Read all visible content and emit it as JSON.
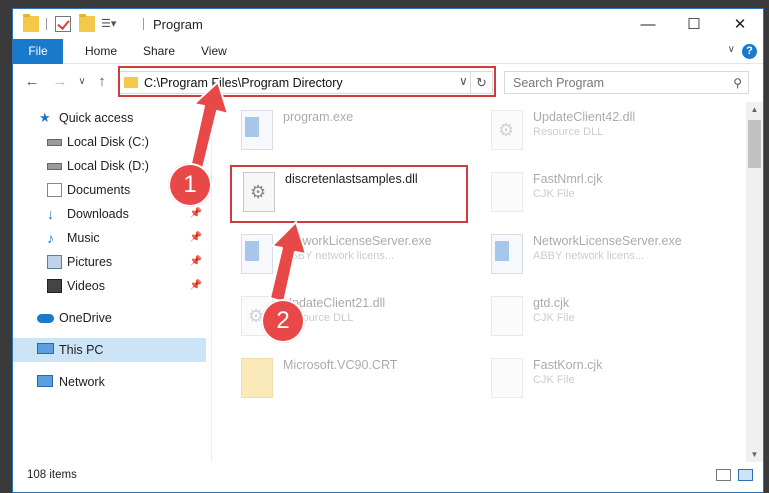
{
  "window": {
    "title": "Program",
    "controls": {
      "minimize": "—",
      "maximize": "☐",
      "close": "✕"
    }
  },
  "ribbon": {
    "tabs": [
      "File",
      "Home",
      "Share",
      "View"
    ],
    "help": "?",
    "collapse": "∨"
  },
  "nav": {
    "back": "←",
    "forward": "→",
    "recent": "∨",
    "up": "↑",
    "address": "C:\\Program Files\\Program Directory",
    "address_drop": "∨",
    "refresh": "↻",
    "search_placeholder": "Search Program",
    "search_icon": "⚲"
  },
  "sidebar": {
    "items": [
      {
        "label": "Quick access",
        "icon": "star-icon",
        "pinned": false
      },
      {
        "label": "Local Disk (C:)",
        "icon": "drive-icon",
        "pinned": false
      },
      {
        "label": "Local Disk (D:)",
        "icon": "drive-icon",
        "pinned": false
      },
      {
        "label": "Documents",
        "icon": "documents-icon",
        "pinned": true
      },
      {
        "label": "Downloads",
        "icon": "download-icon",
        "pinned": true
      },
      {
        "label": "Music",
        "icon": "music-icon",
        "pinned": true
      },
      {
        "label": "Pictures",
        "icon": "pictures-icon",
        "pinned": true
      },
      {
        "label": "Videos",
        "icon": "videos-icon",
        "pinned": true
      },
      {
        "label": "OneDrive",
        "icon": "cloud-icon",
        "pinned": false
      },
      {
        "label": "This PC",
        "icon": "computer-icon",
        "pinned": false,
        "selected": true
      },
      {
        "label": "Network",
        "icon": "network-icon",
        "pinned": false
      }
    ],
    "pin_glyph": "📌"
  },
  "files": [
    {
      "name": "program.exe",
      "sub": "",
      "icon": "app-icon"
    },
    {
      "name": "UpdateClient42.dll",
      "sub": "Resource DLL",
      "icon": "dll-icon"
    },
    {
      "name": "discretenlastsamples.dll",
      "sub": "",
      "icon": "dll-icon",
      "highlighted": true
    },
    {
      "name": "FastNmrl.cjk",
      "sub": "CJK File",
      "icon": "file-icon"
    },
    {
      "name": "NetworkLicenseServer.exe",
      "sub": "ABBY network licens...",
      "icon": "app-icon"
    },
    {
      "name": "NetworkLicenseServer.exe",
      "sub": "ABBY network licens...",
      "icon": "app-icon"
    },
    {
      "name": "UpdateClient21.dll",
      "sub": "Resource DLL",
      "icon": "dll-icon"
    },
    {
      "name": "gtd.cjk",
      "sub": "CJK File",
      "icon": "file-icon"
    },
    {
      "name": "Microsoft.VC90.CRT",
      "sub": "",
      "icon": "folder-icon"
    },
    {
      "name": "FastKorn.cjk",
      "sub": "CJK File",
      "icon": "file-icon"
    }
  ],
  "status": {
    "item_count": "108 items"
  },
  "annotations": {
    "badge1": "1",
    "badge2": "2"
  },
  "colors": {
    "accent": "#1979ca",
    "annotation_red": "#d03b3b",
    "selection": "#cce4f7"
  }
}
